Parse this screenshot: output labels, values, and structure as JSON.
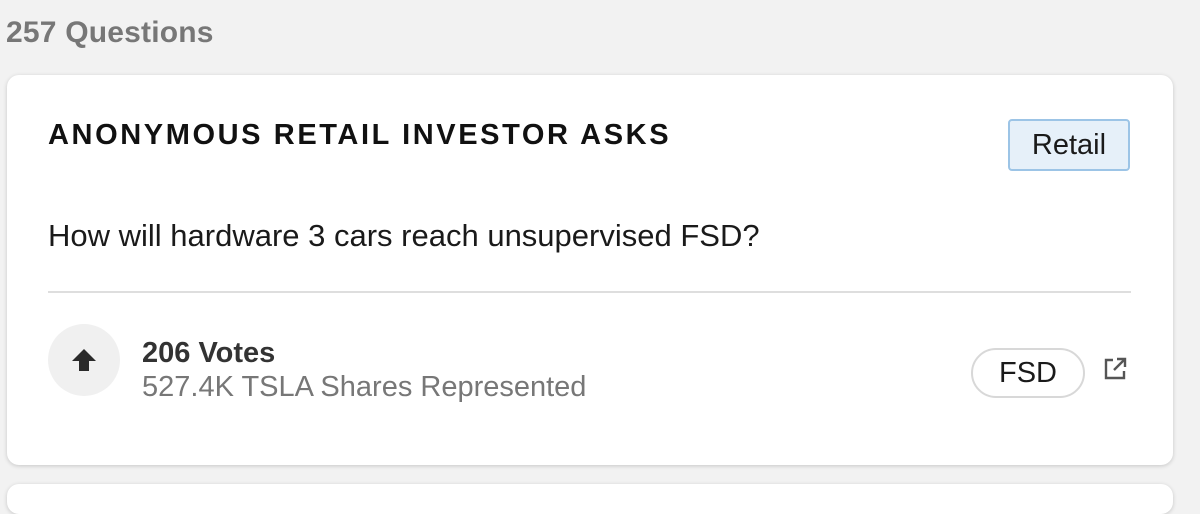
{
  "page": {
    "question_count": "257 Questions"
  },
  "question_card": {
    "asker": "ANONYMOUS RETAIL INVESTOR ASKS",
    "category_tag": "Retail",
    "question": "How will hardware 3 cars reach unsupervised FSD?",
    "votes": "206 Votes",
    "shares_represented": "527.4K TSLA Shares Represented",
    "topic_tag": "FSD"
  },
  "icons": {
    "upvote": "arrow-up-icon",
    "external_link": "external-link-icon"
  },
  "colors": {
    "retail_tag_bg": "#e6f0f9",
    "retail_tag_border": "#9cc4e6",
    "muted_text": "#777777"
  }
}
